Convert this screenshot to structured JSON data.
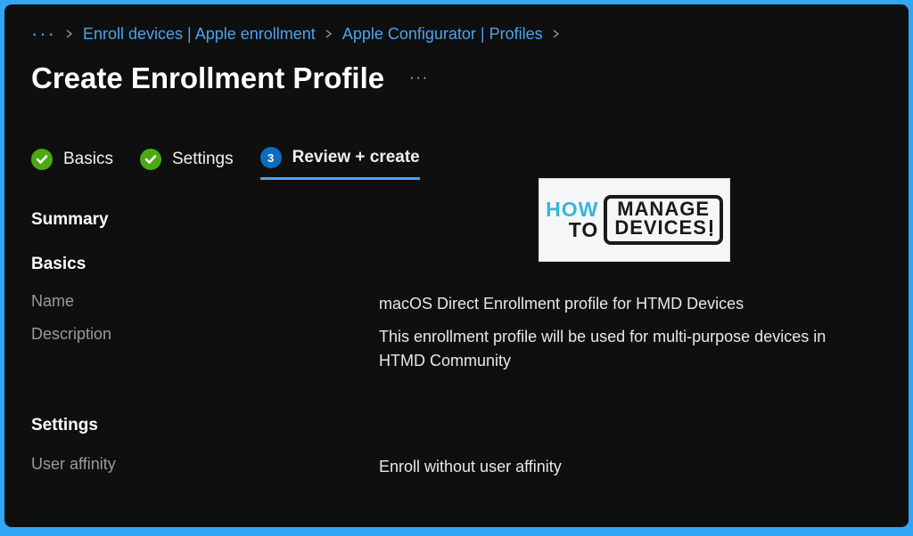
{
  "breadcrumb": {
    "items": [
      {
        "label": "Enroll devices | Apple enrollment"
      },
      {
        "label": "Apple Configurator | Profiles"
      }
    ]
  },
  "page": {
    "title": "Create Enrollment Profile"
  },
  "tabs": {
    "basics": {
      "label": "Basics"
    },
    "settings": {
      "label": "Settings"
    },
    "review": {
      "label": "Review + create",
      "number": "3"
    }
  },
  "summary": {
    "header": "Summary"
  },
  "basics_section": {
    "header": "Basics",
    "name_label": "Name",
    "name_value": "macOS Direct Enrollment profile for HTMD Devices",
    "description_label": "Description",
    "description_value": "This enrollment profile will be used for multi-purpose devices in HTMD Community"
  },
  "settings_section": {
    "header": "Settings",
    "user_affinity_label": "User affinity",
    "user_affinity_value": "Enroll without user affinity"
  },
  "logo": {
    "how": "HOW",
    "to": "TO",
    "manage": "MANAGE",
    "devices": "DEVICES"
  }
}
